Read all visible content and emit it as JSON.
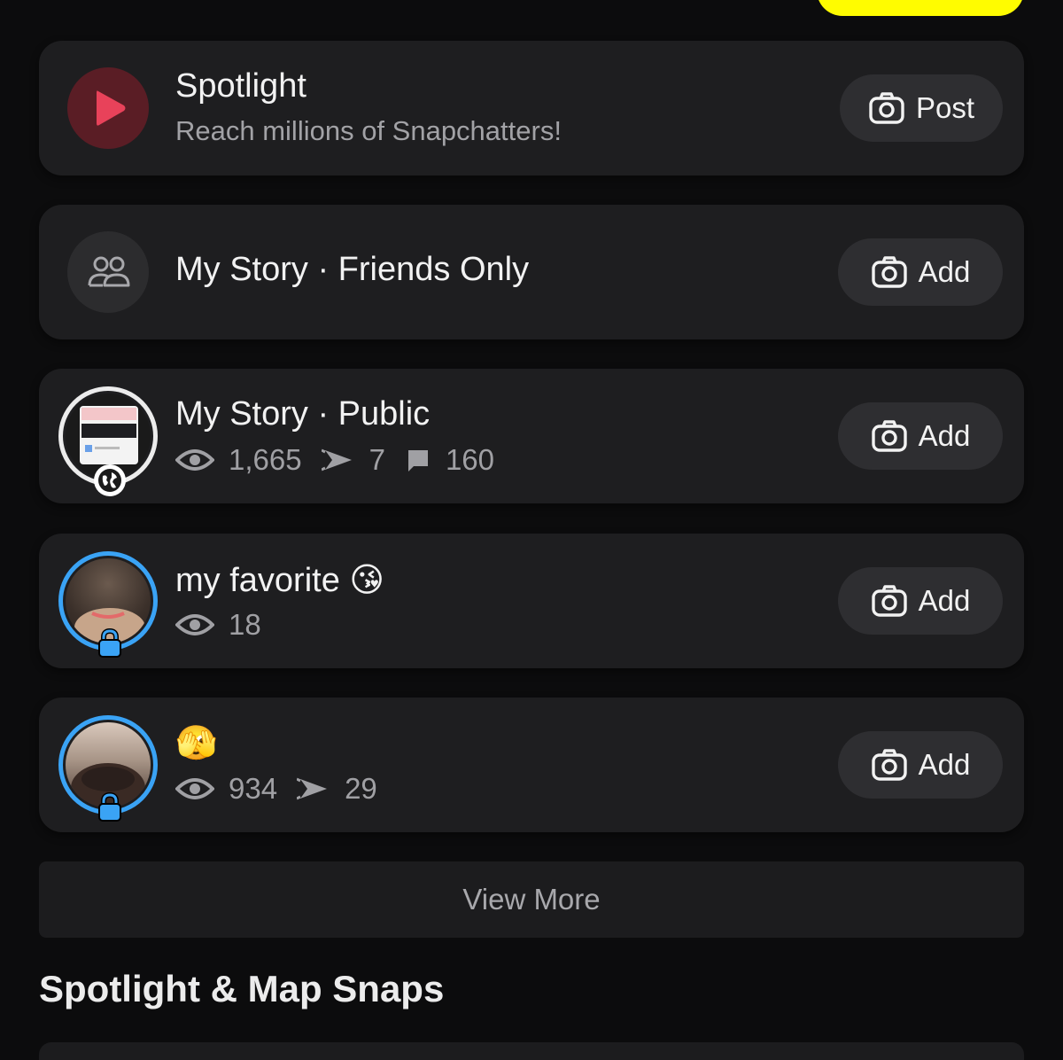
{
  "colors": {
    "accent_yellow": "#fffc00",
    "spotlight_red": "#e8425a",
    "ring_blue": "#3aa3f5",
    "card_bg": "#1e1e20"
  },
  "spotlight": {
    "title": "Spotlight",
    "subtitle": "Reach millions of Snapchatters!",
    "button_label": "Post",
    "icon": "play-icon"
  },
  "stories": [
    {
      "title": "My Story · Friends Only",
      "button_label": "Add",
      "icon": "friends-icon"
    },
    {
      "title": "My Story · Public",
      "button_label": "Add",
      "badge": "globe-icon",
      "stats": {
        "views": "1,665",
        "screenshots": "7",
        "replies": "160"
      }
    },
    {
      "title": "my favorite 😘",
      "button_label": "Add",
      "badge": "lock-icon",
      "stats": {
        "views": "18"
      }
    },
    {
      "title": "🫣",
      "button_label": "Add",
      "badge": "lock-icon",
      "stats": {
        "views": "934",
        "screenshots": "29"
      }
    }
  ],
  "view_more": "View More",
  "section_title": "Spotlight & Map Snaps"
}
